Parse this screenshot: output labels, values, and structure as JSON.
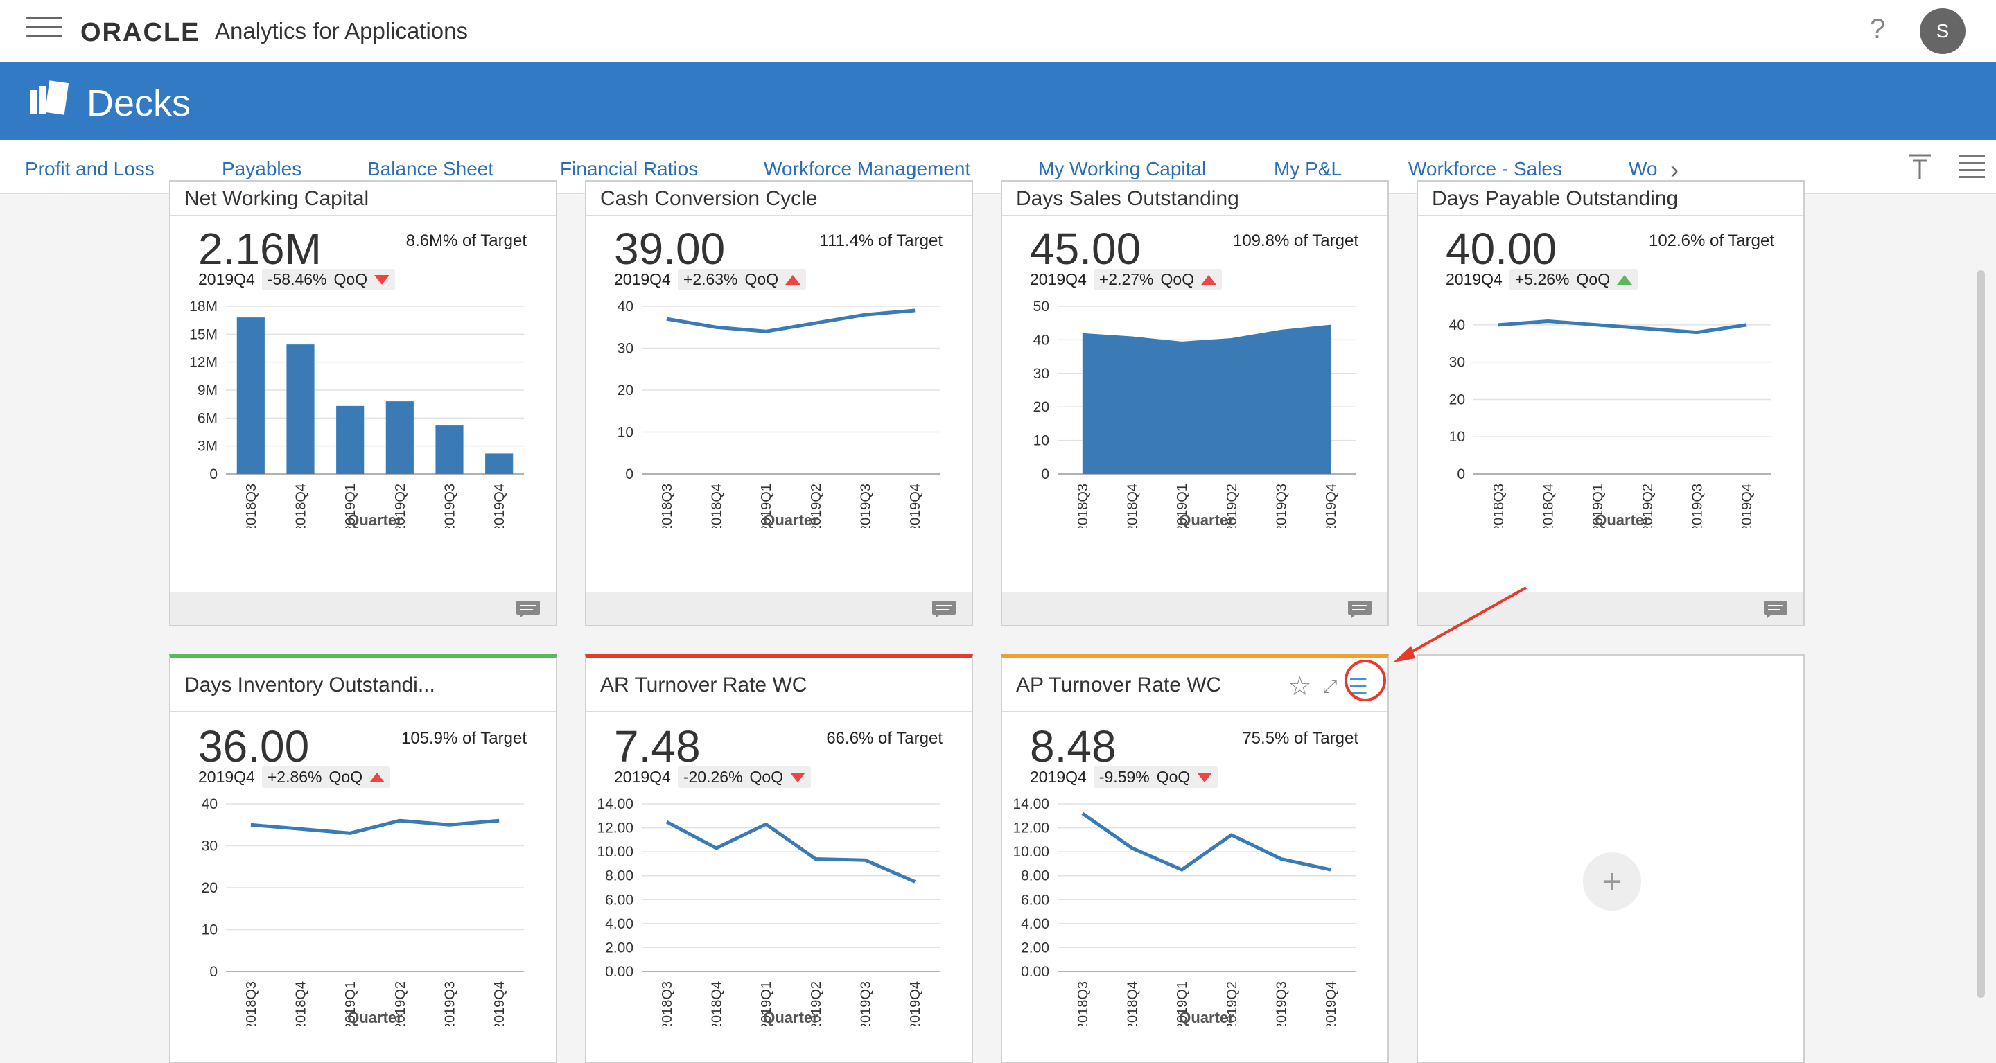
{
  "header": {
    "brand": "ORACLE",
    "app_title": "Analytics for Applications",
    "help": "?",
    "avatar_initial": "S"
  },
  "banner": {
    "title": "Decks"
  },
  "tabs": [
    {
      "label": "Profit and Loss"
    },
    {
      "label": "Payables"
    },
    {
      "label": "Balance Sheet"
    },
    {
      "label": "Financial Ratios"
    },
    {
      "label": "Workforce Management"
    },
    {
      "label": "My Working Capital",
      "active": true
    },
    {
      "label": "My P&L"
    },
    {
      "label": "Workforce - Sales"
    },
    {
      "label": "Wo"
    }
  ],
  "cards": [
    {
      "title": "Net Working Capital",
      "value": "2.16M",
      "target": "8.6M% of Target",
      "period": "2019Q4",
      "change": "-58.46%",
      "qoq": "QoQ",
      "trend": "down",
      "chart": {
        "type": "bar",
        "xlabel": "Quarter",
        "categories": [
          "2018Q3",
          "2018Q4",
          "2019Q1",
          "2019Q2",
          "2019Q3",
          "2019Q4"
        ],
        "values": [
          16.8,
          13.9,
          7.3,
          7.8,
          5.2,
          2.2
        ],
        "y_ticks": [
          "0",
          "3M",
          "6M",
          "9M",
          "12M",
          "15M",
          "18M"
        ],
        "ylim": [
          0,
          18
        ]
      }
    },
    {
      "title": "Cash Conversion Cycle",
      "value": "39.00",
      "target": "111.4% of Target",
      "period": "2019Q4",
      "change": "+2.63%",
      "qoq": "QoQ",
      "trend": "up",
      "chart": {
        "type": "line",
        "xlabel": "Quarter",
        "categories": [
          "2018Q3",
          "2018Q4",
          "2019Q1",
          "2019Q2",
          "2019Q3",
          "2019Q4"
        ],
        "values": [
          37,
          35,
          34,
          36,
          38,
          39
        ],
        "y_ticks": [
          "0",
          "10",
          "20",
          "30",
          "40"
        ],
        "ylim": [
          0,
          40
        ]
      }
    },
    {
      "title": "Days Sales Outstanding",
      "value": "45.00",
      "target": "109.8% of Target",
      "period": "2019Q4",
      "change": "+2.27%",
      "qoq": "QoQ",
      "trend": "up",
      "chart": {
        "type": "area",
        "xlabel": "Quarter",
        "categories": [
          "2018Q3",
          "2018Q4",
          "2019Q1",
          "2019Q2",
          "2019Q3",
          "2019Q4"
        ],
        "values": [
          42,
          41,
          39.5,
          40.5,
          43,
          44.5
        ],
        "y_ticks": [
          "0",
          "10",
          "20",
          "30",
          "40",
          "50"
        ],
        "ylim": [
          0,
          50
        ]
      }
    },
    {
      "title": "Days Payable Outstanding",
      "value": "40.00",
      "target": "102.6% of Target",
      "period": "2019Q4",
      "change": "+5.26%",
      "qoq": "QoQ",
      "trend": "up-green",
      "chart": {
        "type": "line",
        "xlabel": "Quarter",
        "categories": [
          "2018Q3",
          "2018Q4",
          "2019Q1",
          "2019Q2",
          "2019Q3",
          "2019Q4"
        ],
        "values": [
          40,
          41,
          40,
          39,
          38,
          40
        ],
        "y_ticks": [
          "0",
          "10",
          "20",
          "30",
          "40"
        ],
        "ylim": [
          0,
          45
        ]
      }
    },
    {
      "title": "Days Inventory Outstandi...",
      "value": "36.00",
      "target": "105.9% of Target",
      "period": "2019Q4",
      "change": "+2.86%",
      "qoq": "QoQ",
      "trend": "up",
      "accent": "#5cb85c",
      "chart": {
        "type": "line",
        "xlabel": "Quarter",
        "categories": [
          "2018Q3",
          "2018Q4",
          "2019Q1",
          "2019Q2",
          "2019Q3",
          "2019Q4"
        ],
        "values": [
          35,
          34,
          33,
          36,
          35,
          36
        ],
        "y_ticks": [
          "0",
          "10",
          "20",
          "30",
          "40"
        ],
        "ylim": [
          0,
          40
        ]
      }
    },
    {
      "title": "AR Turnover Rate WC",
      "value": "7.48",
      "target": "66.6% of Target",
      "period": "2019Q4",
      "change": "-20.26%",
      "qoq": "QoQ",
      "trend": "down",
      "accent": "#e53b2c",
      "chart": {
        "type": "line",
        "xlabel": "Quarter",
        "categories": [
          "2018Q3",
          "2018Q4",
          "2019Q1",
          "2019Q2",
          "2019Q3",
          "2019Q4"
        ],
        "values": [
          12.5,
          10.3,
          12.3,
          9.4,
          9.3,
          7.5
        ],
        "y_ticks": [
          "0.00",
          "2.00",
          "4.00",
          "6.00",
          "8.00",
          "10.00",
          "12.00",
          "14.00"
        ],
        "ylim": [
          0,
          14
        ]
      }
    },
    {
      "title": "AP Turnover Rate WC",
      "value": "8.48",
      "target": "75.5% of Target",
      "period": "2019Q4",
      "change": "-9.59%",
      "qoq": "QoQ",
      "trend": "down",
      "accent": "#f0a030",
      "chart": {
        "type": "line",
        "xlabel": "Quarter",
        "categories": [
          "2018Q3",
          "2018Q4",
          "2019Q1",
          "2019Q2",
          "2019Q3",
          "2019Q4"
        ],
        "values": [
          13.2,
          10.3,
          8.5,
          11.4,
          9.4,
          8.5
        ],
        "y_ticks": [
          "0.00",
          "2.00",
          "4.00",
          "6.00",
          "8.00",
          "10.00",
          "12.00",
          "14.00"
        ],
        "ylim": [
          0,
          14
        ]
      }
    }
  ],
  "add_card": {
    "label": "+"
  },
  "colors": {
    "brand_blue": "#337ac4",
    "series": "#3b7bb5",
    "annotation": "#e53b2c"
  }
}
